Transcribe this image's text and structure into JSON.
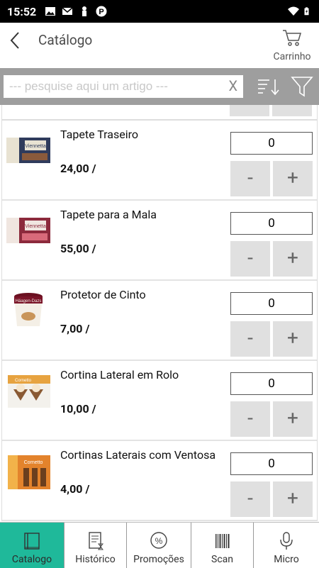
{
  "status_bar": {
    "time": "15:52"
  },
  "header": {
    "title": "Catálogo",
    "cart_label": "Carrinho"
  },
  "search": {
    "placeholder": "--- pesquise aqui um artigo ---",
    "clear_label": "X"
  },
  "products": [
    {
      "name": "Tapete Traseiro",
      "price": "24,00  /",
      "quantity": "0",
      "minus": "-",
      "plus": "+"
    },
    {
      "name": "Tapete para a Mala",
      "price": "55,00  /",
      "quantity": "0",
      "minus": "-",
      "plus": "+"
    },
    {
      "name": "Protetor de Cinto",
      "price": "7,00  /",
      "quantity": "0",
      "minus": "-",
      "plus": "+"
    },
    {
      "name": "Cortina Lateral em Rolo",
      "price": "10,00  /",
      "quantity": "0",
      "minus": "-",
      "plus": "+"
    },
    {
      "name": "Cortinas Laterais com Ventosa",
      "price": "4,00  /",
      "quantity": "0",
      "minus": "-",
      "plus": "+"
    }
  ],
  "bottom_nav": [
    {
      "label": "Catalogo",
      "active": true
    },
    {
      "label": "Histórico",
      "active": false
    },
    {
      "label": "Promoções",
      "active": false
    },
    {
      "label": "Scan",
      "active": false
    },
    {
      "label": "Micro",
      "active": false
    }
  ],
  "colors": {
    "accent": "#1fb99a",
    "search_bar_bg": "#9e9e9e",
    "button_bg": "#e0e0e0"
  }
}
